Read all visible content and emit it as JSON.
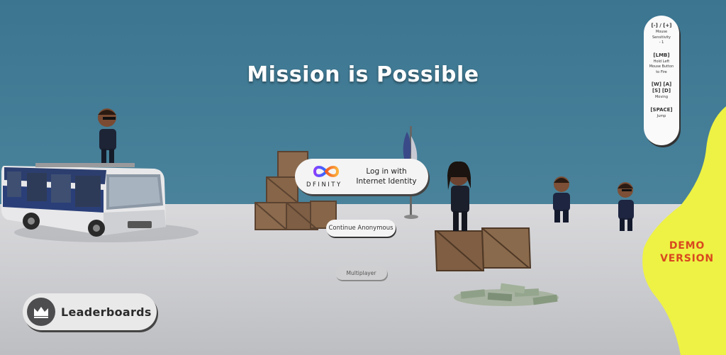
{
  "game": {
    "title": "Mission is Possible"
  },
  "login": {
    "provider_logo_text": "DFINITY",
    "label_line1": "Log in with",
    "label_line2": "Internet Identity"
  },
  "buttons": {
    "continue_anonymous": "Continue Anonymous",
    "multiplayer": "Multiplayer",
    "leaderboards": "Leaderboards"
  },
  "controls": [
    {
      "key": "[-] / [+]",
      "desc": [
        "Mouse",
        "Sensitivity",
        "- 1"
      ]
    },
    {
      "key": "[LMB]",
      "desc": [
        "Hold Left",
        "Mouse Button",
        "to Fire"
      ]
    },
    {
      "key": "[W] [A] [S] [D]",
      "desc": [
        "Moving"
      ]
    },
    {
      "key": "[SPACE]",
      "desc": [
        "Jump"
      ]
    }
  ],
  "demo_badge": {
    "line1": "DEMO",
    "line2": "VERSION"
  },
  "colors": {
    "sky": "#3f7891",
    "ground": "#d4d5d8",
    "demo_blob": "#eef244",
    "demo_text": "#d9481f"
  }
}
